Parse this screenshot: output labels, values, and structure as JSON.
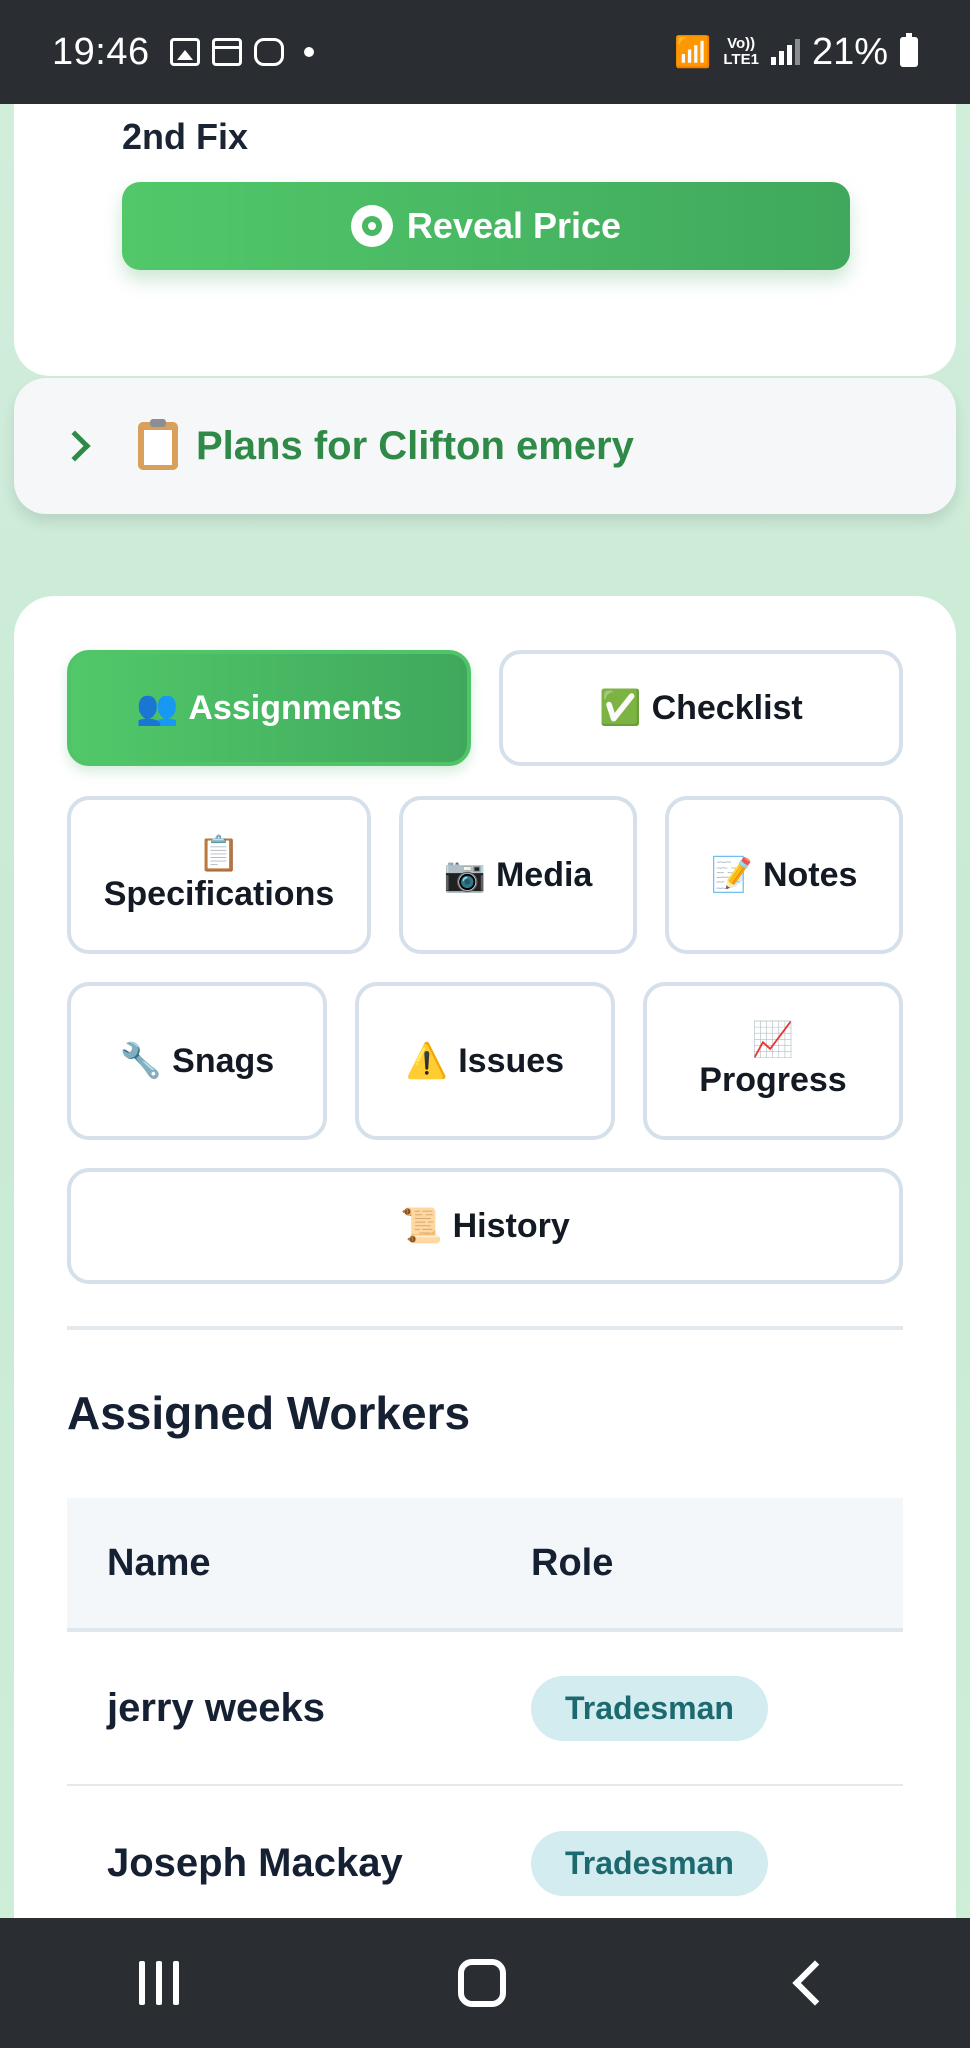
{
  "status_bar": {
    "time": "19:46",
    "lte_label": "Vo))\nLTE1",
    "battery": "21%"
  },
  "job_card": {
    "stage_label": "2nd Fix",
    "reveal_price_label": "Reveal Price"
  },
  "plans": {
    "title": "Plans for Clifton emery"
  },
  "tabs": {
    "assignments": "Assignments",
    "checklist": "Checklist",
    "specifications": "Specifications",
    "media": "Media",
    "notes": "Notes",
    "snags": "Snags",
    "issues": "Issues",
    "progress": "Progress",
    "history": "History"
  },
  "assigned": {
    "title": "Assigned Workers",
    "columns": {
      "name": "Name",
      "role": "Role"
    },
    "rows": [
      {
        "name": "jerry weeks",
        "role": "Tradesman"
      },
      {
        "name": "Joseph Mackay",
        "role": "Tradesman"
      }
    ]
  },
  "colors": {
    "accent_green": "#48b863",
    "plans_green": "#2f8a47",
    "badge_bg": "#d3ecef",
    "badge_text": "#1c6a6f"
  }
}
